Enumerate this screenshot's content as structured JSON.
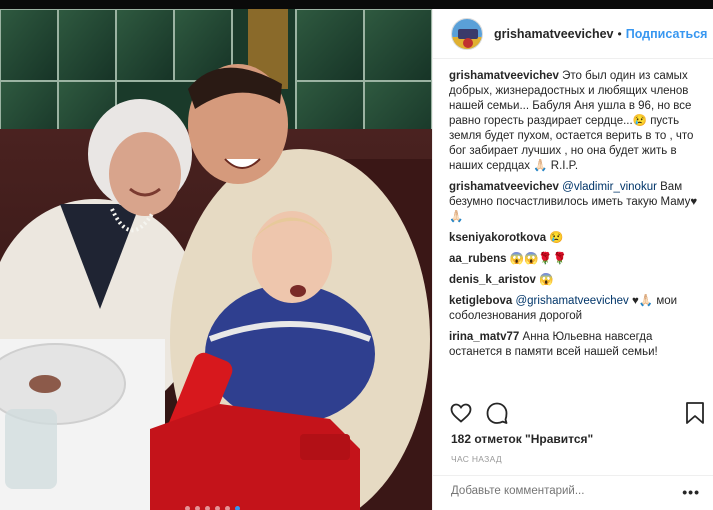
{
  "header": {
    "username": "grishamatveevichev",
    "separator": "•",
    "follow_label": "Подписаться"
  },
  "comments": [
    {
      "user": "grishamatveevichev",
      "mention": "",
      "text": "Это был один из самых добрых, жизнерадостных и любящих членов нашей семьи... Бабуля Аня ушла в 96, но все равно горесть раздирает сердце...😢 пусть земля будет пухом, остается верить в то , что бог забирает лучших , но она будет жить в наших сердцах 🙏🏻 R.I.P."
    },
    {
      "user": "grishamatveevichev",
      "mention": "@vladimir_vinokur",
      "text": "Вам безумно посчастливилось иметь такую Маму♥🙏🏻"
    },
    {
      "user": "kseniyakorotkova",
      "mention": "",
      "text": "😢"
    },
    {
      "user": "aa_rubens",
      "mention": "",
      "text": "😱😱🌹🌹"
    },
    {
      "user": "denis_k_aristov",
      "mention": "",
      "text": "😱"
    },
    {
      "user": "ketiglebova",
      "mention": "@grishamatveevichev",
      "text": "♥🙏🏻 мои соболезнования дорогой"
    },
    {
      "user": "irina_matv77",
      "mention": "",
      "text": "Анна Юльевна навсегда останется в памяти всей нашей семьи!"
    }
  ],
  "actions": {
    "like_icon": "heart-outline-icon",
    "comment_icon": "comment-bubble-icon",
    "save_icon": "bookmark-icon"
  },
  "likes_text": "182 отметок \"Нравится\"",
  "time_text": "ЧАС НАЗАД",
  "add_comment": {
    "placeholder": "Добавьте комментарий...",
    "more_label": "•••"
  },
  "carousel": {
    "total": 6,
    "active_index": 5
  },
  "colors": {
    "accent": "#3897f0",
    "text": "#262626",
    "muted": "#999999",
    "border": "#efefef",
    "mention": "#003569"
  }
}
